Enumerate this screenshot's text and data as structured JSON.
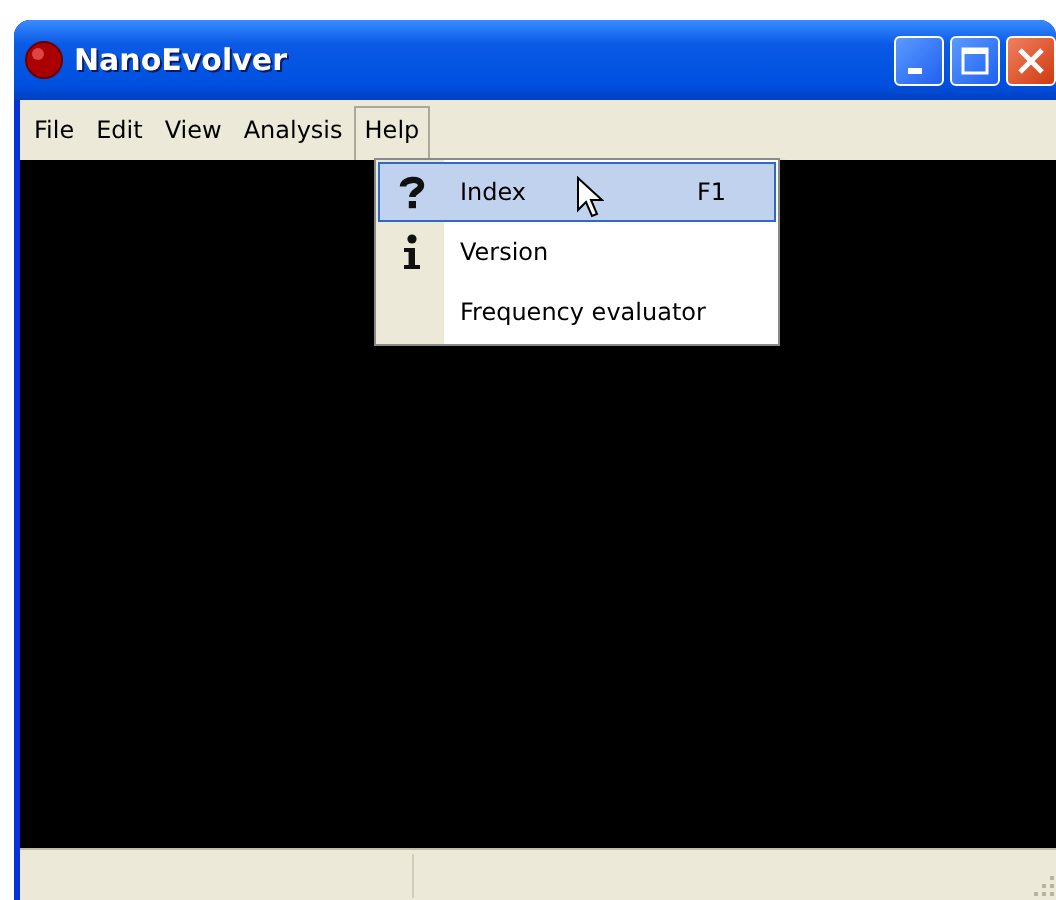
{
  "window": {
    "title": "NanoEvolver"
  },
  "menu_bar": [
    {
      "label": "File",
      "selected": false
    },
    {
      "label": "Edit",
      "selected": false
    },
    {
      "label": "View",
      "selected": false
    },
    {
      "label": "Analysis",
      "selected": false
    },
    {
      "label": "Help",
      "selected": true
    }
  ],
  "help_menu": [
    {
      "label": "Index",
      "shortcut": "F1",
      "kind": "question",
      "selected": true
    },
    {
      "label": "Version",
      "kind": "info",
      "selected": false
    },
    {
      "label": "Frequency evaluator",
      "kind": "plain",
      "selected": false
    }
  ]
}
